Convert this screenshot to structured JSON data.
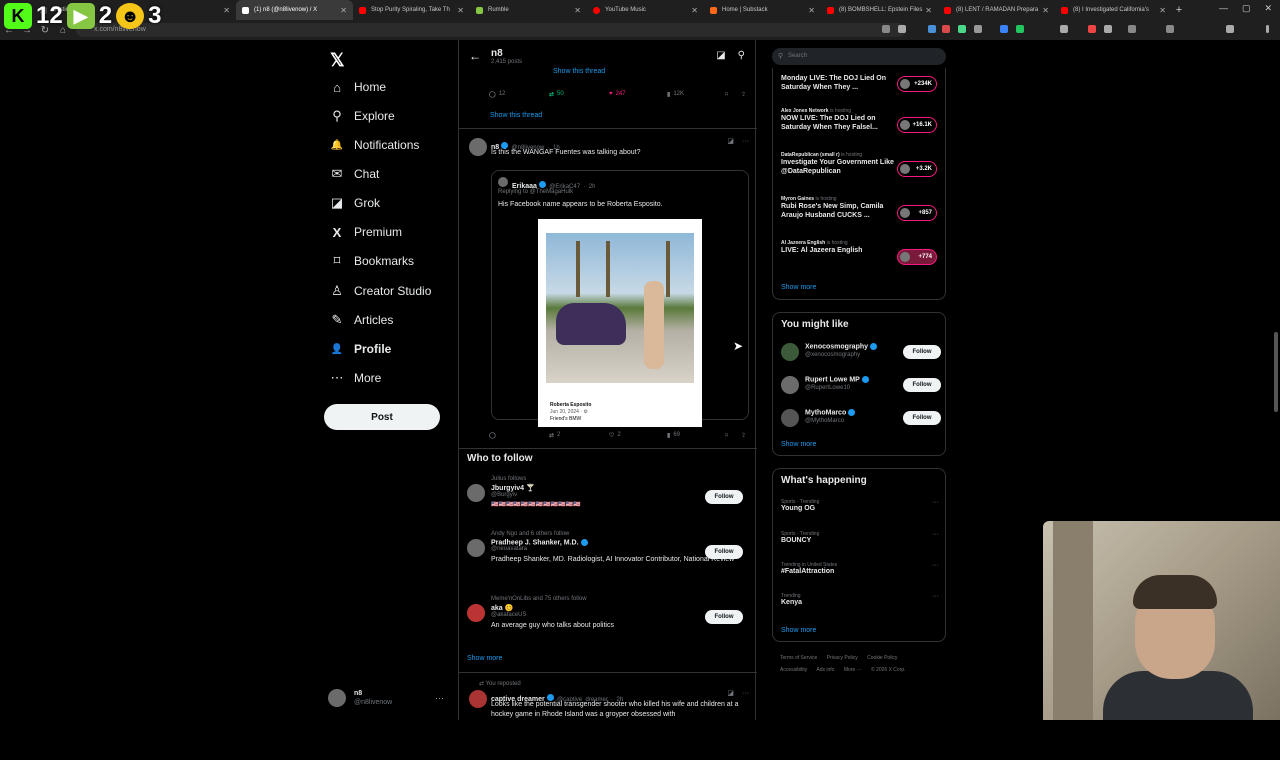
{
  "browser": {
    "tabs": [
      {
        "title": "ifications / X",
        "color": "#555555",
        "active": false
      },
      {
        "title": "",
        "color": "#555555",
        "active": false
      },
      {
        "title": "(1) n8 (@n8livenow) / X",
        "color": "#ffffff",
        "active": true
      },
      {
        "title": "Stop Purity Spiraling, Take Th",
        "color": "#ff0000",
        "active": false
      },
      {
        "title": "Rumble",
        "color": "#85c742",
        "active": false
      },
      {
        "title": "YouTube Music",
        "color": "#ff0000",
        "active": false
      },
      {
        "title": "Home | Substack",
        "color": "#ff6719",
        "active": false
      },
      {
        "title": "(8) BOMBSHELL: Epstein Files",
        "color": "#ff0000",
        "active": false
      },
      {
        "title": "(8) LENT / RAMADAN Prepara",
        "color": "#ff0000",
        "active": false
      },
      {
        "title": "(8) I Investigated California's",
        "color": "#ff0000",
        "active": false
      }
    ],
    "url": "x.com/n8livenow",
    "overlay": {
      "kick_count": "12",
      "rumble_count": "2",
      "third_count": "3"
    }
  },
  "nav": {
    "items": [
      {
        "label": "Home",
        "icon": "home-icon",
        "glyph": "⌂"
      },
      {
        "label": "Explore",
        "icon": "search-icon",
        "glyph": "⚲"
      },
      {
        "label": "Notifications",
        "icon": "bell-icon",
        "glyph": "🔔"
      },
      {
        "label": "Chat",
        "icon": "envelope-icon",
        "glyph": "✉"
      },
      {
        "label": "Grok",
        "icon": "grok-icon",
        "glyph": "◪"
      },
      {
        "label": "Premium",
        "icon": "x-icon",
        "glyph": "X"
      },
      {
        "label": "Bookmarks",
        "icon": "bookmark-icon",
        "glyph": "⌑"
      },
      {
        "label": "Creator Studio",
        "icon": "creator-icon",
        "glyph": "♙"
      },
      {
        "label": "Articles",
        "icon": "articles-icon",
        "glyph": "✎"
      },
      {
        "label": "Profile",
        "icon": "person-icon",
        "glyph": "👤"
      },
      {
        "label": "More",
        "icon": "more-icon",
        "glyph": "⋯"
      }
    ],
    "post_label": "Post",
    "account": {
      "name": "n8",
      "handle": "@n8livenow"
    }
  },
  "profile_header": {
    "name": "n8",
    "posts": "2,415 posts"
  },
  "thread_top": {
    "show_thread_top": "Show this thread",
    "stats": {
      "replies": "12",
      "reposts": "50",
      "likes": "247",
      "views": "12K"
    },
    "show_thread": "Show this thread"
  },
  "tweet": {
    "name": "n8",
    "handle": "@n8livenow",
    "time": "1h",
    "text": "Is this the WANGAF Fuentes was talking about?",
    "quote": {
      "name": "Erikaaa",
      "handle": "@ErikaC47",
      "time": "2h",
      "replying": "Replying to @TheMagaHulk",
      "text": "His Facebook name appears to be Roberta Esposito.",
      "card_name": "Roberta Esposito",
      "card_date": "Jun 20, 2024 · ⚙",
      "card_caption": "Friend's BMW"
    },
    "stats": {
      "replies": "",
      "reposts": "2",
      "likes": "2",
      "views": "69"
    }
  },
  "who_to_follow": {
    "title": "Who to follow",
    "items": [
      {
        "social": "Julius follows",
        "name": "Jburgyiv4 🍸",
        "handle": "@Burgyiv",
        "bio": "🇺🇸🇺🇸🇺🇸🇺🇸🇺🇸🇺🇸🇺🇸🇺🇸🇺🇸🇺🇸🇺🇸🇺🇸",
        "follow": "Follow"
      },
      {
        "social": "Andy Ngo and 6 others follow",
        "name": "Pradheep J. Shanker, M.D.",
        "handle": "@neoavatara",
        "bio": "Pradheep Shanker, MD. Radiologist, AI Innovator Contributor, National Review",
        "follow": "Follow"
      },
      {
        "social": "Meme'nOnLibs and 75 others follow",
        "name": "aka 😊",
        "handle": "@akafaceUS",
        "bio": "An average guy who talks about politics",
        "follow": "Follow"
      }
    ],
    "show_more": "Show more"
  },
  "bottom_tweet": {
    "repost_label": "You reposted",
    "name": "captive dreamer",
    "handle": "@captive_dreamer",
    "time": "2h",
    "text": "Looks like the potential transgender shooter who killed his wife and children at a hockey game in Rhode Island was a groyper obsessed with"
  },
  "search": {
    "placeholder": "Search"
  },
  "live": {
    "items": [
      {
        "host": "",
        "hosting": "",
        "title": "Monday LIVE: The DOJ Lied On Saturday When They ...",
        "count": "+234K"
      },
      {
        "host": "Alex Jones Network",
        "hosting": "is hosting",
        "title": "NOW LIVE: The DOJ Lied on Saturday When They Falsel...",
        "count": "+16.1K"
      },
      {
        "host": "DataRepublican (small r)",
        "hosting": "is hosting",
        "title": "Investigate Your Government Like @DataRepublican",
        "count": "+3.2K"
      },
      {
        "host": "Myron Gaines",
        "hosting": "is hosting",
        "title": "Rubi Rose's New Simp, Camila Araujo Husband CUCKS ...",
        "count": "+857"
      },
      {
        "host": "Al Jazeera English",
        "hosting": "is hosting",
        "title": "LIVE: Al Jazeera English",
        "count": "+774"
      }
    ],
    "show_more": "Show more"
  },
  "you_might_like": {
    "title": "You might like",
    "items": [
      {
        "name": "Xenocosmography",
        "handle": "@xenocosmography",
        "follow": "Follow"
      },
      {
        "name": "Rupert Lowe MP",
        "handle": "@RupertLowe10",
        "follow": "Follow"
      },
      {
        "name": "MythoMarco",
        "handle": "@MythoMarco",
        "follow": "Follow"
      }
    ],
    "show_more": "Show more"
  },
  "whats_happening": {
    "title": "What's happening",
    "items": [
      {
        "category": "Sports · Trending",
        "topic": "Young OG"
      },
      {
        "category": "Sports · Trending",
        "topic": "BOUNCY"
      },
      {
        "category": "Trending in United States",
        "topic": "#FatalAttraction"
      },
      {
        "category": "Trending",
        "topic": "Kenya"
      }
    ],
    "show_more": "Show more"
  },
  "footer": {
    "links": [
      "Terms of Service",
      "Privacy Policy",
      "Cookie Policy",
      "Accessibility",
      "Ads info",
      "More ···",
      "© 2026 X Corp."
    ]
  },
  "colors": {
    "accent": "#1d9bf0",
    "like": "#f91880",
    "repost": "#00ba7c"
  }
}
